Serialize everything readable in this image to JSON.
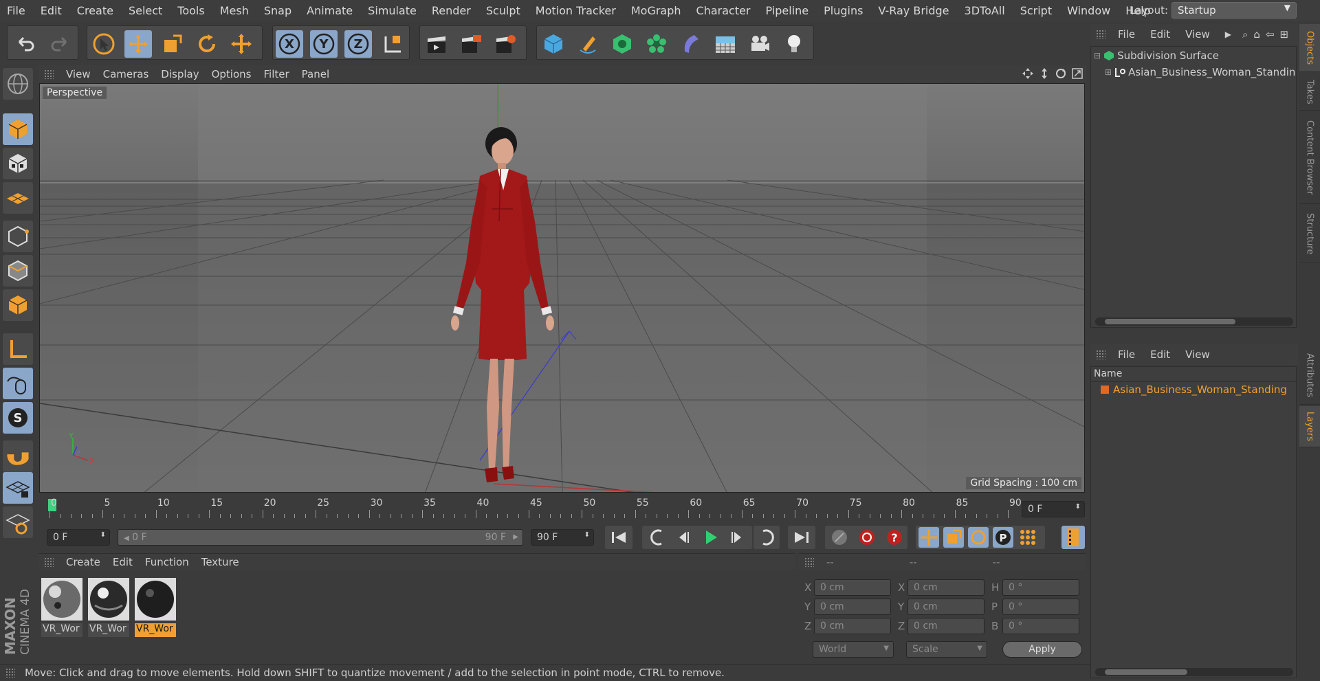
{
  "menu": [
    "File",
    "Edit",
    "Create",
    "Select",
    "Tools",
    "Mesh",
    "Snap",
    "Animate",
    "Simulate",
    "Render",
    "Sculpt",
    "Motion Tracker",
    "MoGraph",
    "Character",
    "Pipeline",
    "Plugins",
    "V-Ray Bridge",
    "3DToAll",
    "Script",
    "Window",
    "Help"
  ],
  "layout": {
    "label": "Layout:",
    "value": "Startup"
  },
  "viewport": {
    "menu": [
      "View",
      "Cameras",
      "Display",
      "Options",
      "Filter",
      "Panel"
    ],
    "label": "Perspective",
    "grid_spacing": "Grid Spacing : 100 cm",
    "axis_y": "Y",
    "axis_z": "Z",
    "axis_x": "X"
  },
  "timeline": {
    "ticks": [
      "0",
      "5",
      "10",
      "15",
      "20",
      "25",
      "30",
      "35",
      "40",
      "45",
      "50",
      "55",
      "60",
      "65",
      "70",
      "75",
      "80",
      "85",
      "90"
    ],
    "current_frame": "0 F"
  },
  "controls": {
    "start_field": "0 F",
    "slider_left": "0 F",
    "slider_right": "90 F",
    "end_field": "90 F"
  },
  "material_manager": {
    "menu": [
      "Create",
      "Edit",
      "Function",
      "Texture"
    ],
    "materials": [
      {
        "label": "VR_Wor",
        "selected": false
      },
      {
        "label": "VR_Wor",
        "selected": false
      },
      {
        "label": "VR_Wor",
        "selected": true
      }
    ]
  },
  "coordinates": {
    "headers": [
      "--",
      "--",
      "--"
    ],
    "rows": [
      {
        "a": "X",
        "av": "0 cm",
        "b": "X",
        "bv": "0 cm",
        "c": "H",
        "cv": "0 °"
      },
      {
        "a": "Y",
        "av": "0 cm",
        "b": "Y",
        "bv": "0 cm",
        "c": "P",
        "cv": "0 °"
      },
      {
        "a": "Z",
        "av": "0 cm",
        "b": "Z",
        "bv": "0 cm",
        "c": "B",
        "cv": "0 °"
      }
    ],
    "world": "World",
    "scale": "Scale",
    "apply": "Apply"
  },
  "objects_panel": {
    "menu": [
      "File",
      "Edit",
      "View"
    ],
    "items": [
      "Subdivision Surface",
      "Asian_Business_Woman_Standin"
    ]
  },
  "layers_panel": {
    "menu": [
      "File",
      "Edit",
      "View"
    ],
    "column": "Name",
    "items": [
      "Asian_Business_Woman_Standing"
    ]
  },
  "side_tabs": [
    "Objects",
    "Takes",
    "Content Browser",
    "Structure",
    "Attributes",
    "Layers"
  ],
  "status": "Move: Click and drag to move elements. Hold down SHIFT to quantize movement / add to the selection in point mode, CTRL to remove.",
  "logo": "MAXON CINEMA 4D",
  "colors": {
    "accent": "#f0a030",
    "active": "#8aa6c9",
    "selected_text": "#f0a030"
  }
}
